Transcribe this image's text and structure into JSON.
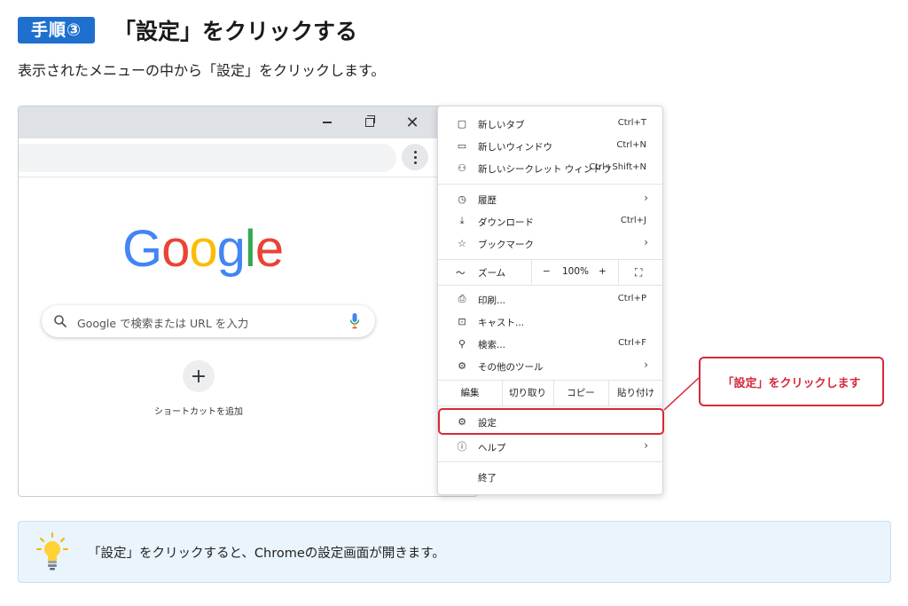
{
  "header": {
    "step_badge": "手順③",
    "title": "「設定」をクリックする",
    "intro": "表示されたメニューの中から「設定」をクリックします。"
  },
  "browser": {
    "window_controls": [
      "minimize-icon",
      "maximize-icon",
      "close-icon"
    ],
    "logo_text": "Google",
    "search_placeholder": "Google で検索または URL を入力",
    "shortcut_plus": "+",
    "shortcut_label": "ショートカットを追加"
  },
  "menu": {
    "items_top": [
      {
        "label": "新しいタブ",
        "shortcut": "Ctrl+T",
        "icon": "new-tab-icon"
      },
      {
        "label": "新しいウィンドウ",
        "shortcut": "Ctrl+N",
        "icon": "new-window-icon"
      },
      {
        "label": "新しいシークレット ウィンドウ",
        "shortcut": "Ctrl+Shift+N",
        "icon": "incognito-icon"
      }
    ],
    "items_mid": [
      {
        "label": "履歴",
        "icon": "history-icon",
        "submenu": true
      },
      {
        "label": "ダウンロード",
        "shortcut": "Ctrl+J",
        "icon": "download-icon"
      },
      {
        "label": "ブックマーク",
        "icon": "bookmark-star-icon",
        "submenu": true
      }
    ],
    "zoom": {
      "label": "ズーム",
      "minus": "−",
      "value": "100%",
      "plus": "+"
    },
    "items_tools": [
      {
        "label": "印刷...",
        "shortcut": "Ctrl+P",
        "icon": "print-icon"
      },
      {
        "label": "キャスト...",
        "icon": "cast-icon"
      },
      {
        "label": "検索...",
        "shortcut": "Ctrl+F",
        "icon": "find-icon"
      },
      {
        "label": "その他のツール",
        "icon": "more-tools-icon",
        "submenu": true
      }
    ],
    "edit": {
      "label": "編集",
      "cut": "切り取り",
      "copy": "コピー",
      "paste": "貼り付け"
    },
    "settings": {
      "label": "設定",
      "icon": "gear-icon"
    },
    "help": {
      "label": "ヘルプ",
      "icon": "help-icon"
    },
    "exit": {
      "label": "終了"
    },
    "arrow": "›"
  },
  "callout": {
    "text": "「設定」をクリックします",
    "color": "#d6283a"
  },
  "tip": {
    "text": "「設定」をクリックすると、Chromeの設定画面が開きます。"
  },
  "colors": {
    "badge": "#1f6fcf",
    "tip_bg": "#eaf4fc",
    "highlight": "#d6283a"
  }
}
